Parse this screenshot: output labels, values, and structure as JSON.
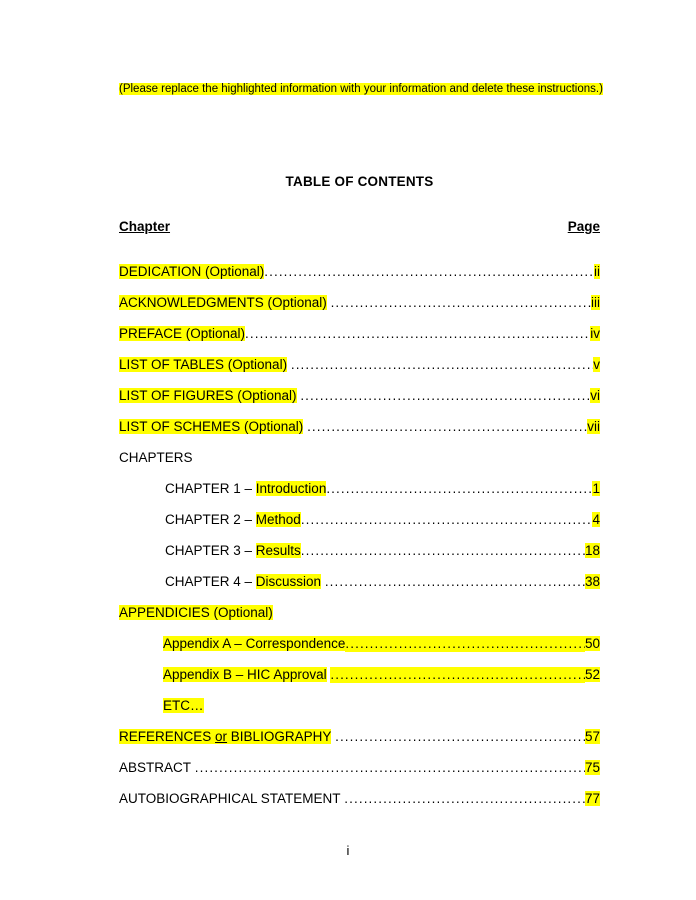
{
  "document": {
    "instructions": "(Please replace the highlighted information with your information and delete these instructions.)",
    "title": "TABLE OF CONTENTS",
    "folio": "i",
    "highlight_color": "#ffff00"
  },
  "columns": {
    "chapter_heading": "Chapter",
    "page_heading": "Page"
  },
  "entries": [
    {
      "title": "DEDICATION (Optional)",
      "page": "ii",
      "indent": "none",
      "title_highlighted": true,
      "page_highlighted": true,
      "leader_highlighted": false,
      "gap_after_title": false,
      "leader": true
    },
    {
      "title": "ACKNOWLEDGMENTS (Optional)",
      "page": "iii",
      "indent": "none",
      "title_highlighted": true,
      "page_highlighted": true,
      "leader_highlighted": false,
      "gap_after_title": true,
      "leader": true
    },
    {
      "title": "PREFACE (Optional)",
      "page": "iv",
      "indent": "none",
      "title_highlighted": true,
      "page_highlighted": true,
      "leader_highlighted": false,
      "gap_after_title": false,
      "leader": true
    },
    {
      "title": "LIST OF TABLES (Optional)",
      "page": "v",
      "indent": "none",
      "title_highlighted": true,
      "page_highlighted": true,
      "leader_highlighted": false,
      "gap_after_title": true,
      "leader": true
    },
    {
      "title": "LIST OF FIGURES (Optional)",
      "page": "vi",
      "indent": "none",
      "title_highlighted": true,
      "page_highlighted": true,
      "leader_highlighted": false,
      "gap_after_title": true,
      "leader": true
    },
    {
      "title": "LIST OF SCHEMES (Optional)",
      "page": "vii",
      "indent": "none",
      "title_highlighted": true,
      "page_highlighted": true,
      "leader_highlighted": false,
      "gap_after_title": true,
      "leader": true
    },
    {
      "title": "CHAPTERS",
      "page": "",
      "indent": "none",
      "title_highlighted": false,
      "page_highlighted": false,
      "leader_highlighted": false,
      "gap_after_title": false,
      "leader": false
    },
    {
      "prefix": "CHAPTER 1 – ",
      "title": "Introduction",
      "page": "1",
      "indent": "chapter",
      "title_highlighted": true,
      "page_highlighted": true,
      "leader_highlighted": false,
      "gap_after_title": false,
      "leader": true
    },
    {
      "prefix": "CHAPTER 2 – ",
      "title": "Method",
      "page": "4",
      "indent": "chapter",
      "title_highlighted": true,
      "page_highlighted": true,
      "leader_highlighted": false,
      "gap_after_title": false,
      "leader": true
    },
    {
      "prefix": "CHAPTER 3 – ",
      "title": "Results",
      "page": "18",
      "indent": "chapter",
      "title_highlighted": true,
      "page_highlighted": true,
      "leader_highlighted": false,
      "gap_after_title": false,
      "leader": true
    },
    {
      "prefix": "CHAPTER 4 – ",
      "title": "Discussion",
      "page": "38",
      "indent": "chapter",
      "title_highlighted": true,
      "page_highlighted": true,
      "leader_highlighted": false,
      "gap_after_title": true,
      "leader": true
    },
    {
      "title": "APPENDICIES (Optional)",
      "page": "",
      "indent": "none",
      "title_highlighted": true,
      "page_highlighted": false,
      "leader_highlighted": false,
      "gap_after_title": false,
      "leader": false
    },
    {
      "title": "Appendix A – Correspondence",
      "page": "50",
      "indent": "appendix",
      "title_highlighted": true,
      "page_highlighted": true,
      "leader_highlighted": true,
      "gap_after_title": false,
      "leader": true
    },
    {
      "title": "Appendix B – HIC Approval",
      "page": "52",
      "indent": "appendix",
      "title_highlighted": true,
      "page_highlighted": true,
      "leader_highlighted": true,
      "gap_after_title": true,
      "leader": true
    },
    {
      "title": "ETC…",
      "page": "",
      "indent": "appendix",
      "title_highlighted": true,
      "page_highlighted": false,
      "leader_highlighted": false,
      "gap_after_title": false,
      "leader": false
    },
    {
      "title": "REFERENCES  or  BIBLIOGRAPHY",
      "title_parts": [
        {
          "text": "REFERENCES  ",
          "underline": false
        },
        {
          "text": "or",
          "underline": true
        },
        {
          "text": "  BIBLIOGRAPHY",
          "underline": false
        }
      ],
      "page": "57",
      "indent": "none",
      "title_highlighted": true,
      "page_highlighted": true,
      "leader_highlighted": false,
      "gap_after_title": true,
      "leader": true
    },
    {
      "title": "ABSTRACT",
      "page": "75",
      "indent": "none",
      "title_highlighted": false,
      "page_highlighted": true,
      "leader_highlighted": false,
      "gap_after_title": true,
      "leader": true
    },
    {
      "title": "AUTOBIOGRAPHICAL STATEMENT",
      "page": "77",
      "indent": "none",
      "title_highlighted": false,
      "page_highlighted": true,
      "leader_highlighted": false,
      "gap_after_title": true,
      "leader": true
    }
  ]
}
